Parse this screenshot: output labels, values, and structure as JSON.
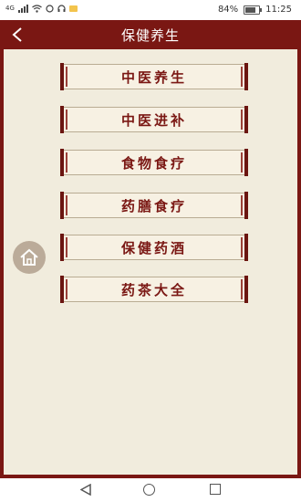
{
  "status_bar": {
    "network": "4G",
    "battery": "84%",
    "time": "11:25"
  },
  "header": {
    "title": "保健养生"
  },
  "menu": [
    {
      "label": "中医养生"
    },
    {
      "label": "中医进补"
    },
    {
      "label": "食物食疗"
    },
    {
      "label": "药膳食疗"
    },
    {
      "label": "保健药酒"
    },
    {
      "label": "药茶大全"
    }
  ],
  "icons": {
    "back": "back-arrow-icon",
    "home": "home-icon",
    "nav_back": "triangle-back-icon",
    "nav_home": "circle-home-icon",
    "nav_recent": "square-recent-icon"
  },
  "colors": {
    "header_bg": "#7a1713",
    "parchment": "#f1ecdd",
    "button_text": "#7a1713",
    "home_button": "#b6a592"
  }
}
